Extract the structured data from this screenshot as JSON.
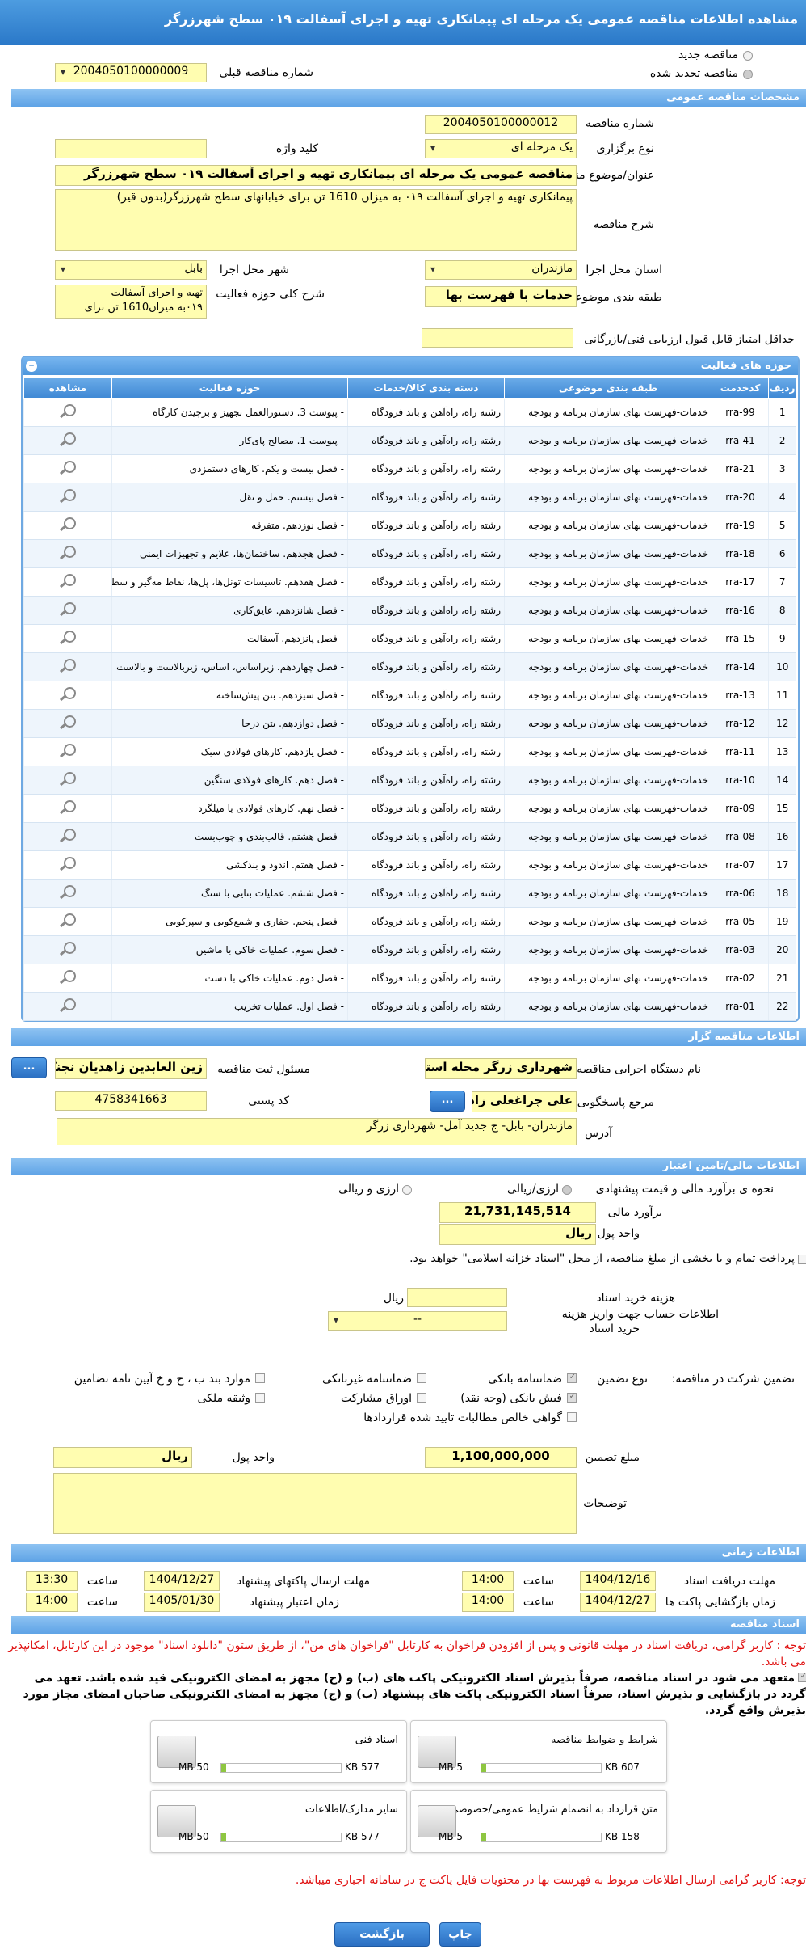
{
  "title": "مشاهده اطلاعات مناقصه عمومی یک مرحله ای پیمانکاری تهیه و اجرای آسفالت ۰۱۹ سطح شهرزرگر",
  "top": {
    "new_tender": "مناقصه جدید",
    "renewed_tender": "مناقصه تجدید شده",
    "prev_number_label": "شماره مناقصه قبلی",
    "prev_number": "2004050100000009"
  },
  "general": {
    "header": "مشخصات مناقصه عمومی",
    "number_label": "شماره مناقصه",
    "number": "2004050100000012",
    "type_label": "نوع برگزاری",
    "type": "یک مرحله ای",
    "keyword_label": "کلید واژه",
    "keyword": "",
    "subject_label": "عنوان/موضوع مناقصه",
    "subject": "مناقصه عمومی یک مرحله ای پیمانکاری تهیه و اجرای آسفالت ۰۱۹ سطح شهرزرگر",
    "desc_label": "شرح مناقصه",
    "desc": "پیمانکاری تهیه و اجرای آسفالت ۰۱۹ به میزان 1610 تن برای خیابانهای سطح شهرزرگر(بدون قیر)",
    "province_label": "استان محل اجرا",
    "province": "مازندران",
    "city_label": "شهر محل اجرا",
    "city": "بابل",
    "category_label": "طبقه بندی موضوعی",
    "category": "خدمات با فهرست بها",
    "scope_label": "شرح کلی حوزه فعالیت",
    "scope_line1": "تهیه و اجرای آسفالت",
    "scope_line2": "۰۱۹به میزان1610 تن برای",
    "min_score_label": "حداقل امتیاز قابل قبول ارزیابی فنی/بازرگانی",
    "min_score": ""
  },
  "activities": {
    "header": "حوزه های فعالیت",
    "toggle": "−",
    "columns": [
      "ردیف",
      "کدخدمت",
      "طبقه بندی موضوعی",
      "دسته بندی کالا/خدمات",
      "حوزه فعالیت",
      "مشاهده"
    ],
    "rows": [
      [
        "1",
        "rra-99",
        "خدمات-فهرست بهای سازمان برنامه و بودجه",
        "رشته راه، راه‌آهن و باند فرودگاه",
        "- پیوست 3. دستورالعمل تجهیز و برچیدن کارگاه"
      ],
      [
        "2",
        "rra-41",
        "خدمات-فهرست بهای سازمان برنامه و بودجه",
        "رشته راه، راه‌آهن و باند فرودگاه",
        "- پیوست 1. مصالح پای‌کار"
      ],
      [
        "3",
        "rra-21",
        "خدمات-فهرست بهای سازمان برنامه و بودجه",
        "رشته راه، راه‌آهن و باند فرودگاه",
        "- فصل بیست و یکم. کارهای دستمزدی"
      ],
      [
        "4",
        "rra-20",
        "خدمات-فهرست بهای سازمان برنامه و بودجه",
        "رشته راه، راه‌آهن و باند فرودگاه",
        "- فصل بیستم. حمل و نقل"
      ],
      [
        "5",
        "rra-19",
        "خدمات-فهرست بهای سازمان برنامه و بودجه",
        "رشته راه، راه‌آهن و باند فرودگاه",
        "- فصل نوزدهم. متفرقه"
      ],
      [
        "6",
        "rra-18",
        "خدمات-فهرست بهای سازمان برنامه و بودجه",
        "رشته راه، راه‌آهن و باند فرودگاه",
        "- فصل هجدهم. ساختمان‌ها، علایم و تجهیزات ایمنی"
      ],
      [
        "7",
        "rra-17",
        "خدمات-فهرست بهای سازمان برنامه و بودجه",
        "رشته راه، راه‌آهن و باند فرودگاه",
        "- فصل هفدهم. تاسیسات تونل‌ها، پل‌ها، نقاط مه‌گیر و سطوح پروازی"
      ],
      [
        "8",
        "rra-16",
        "خدمات-فهرست بهای سازمان برنامه و بودجه",
        "رشته راه، راه‌آهن و باند فرودگاه",
        "- فصل شانزدهم. عایق‌کاری"
      ],
      [
        "9",
        "rra-15",
        "خدمات-فهرست بهای سازمان برنامه و بودجه",
        "رشته راه، راه‌آهن و باند فرودگاه",
        "- فصل پانزدهم. آسفالت"
      ],
      [
        "10",
        "rra-14",
        "خدمات-فهرست بهای سازمان برنامه و بودجه",
        "رشته راه، راه‌آهن و باند فرودگاه",
        "- فصل چهاردهم. زیراساس، اساس، زیربالاست و بالاست"
      ],
      [
        "11",
        "rra-13",
        "خدمات-فهرست بهای سازمان برنامه و بودجه",
        "رشته راه، راه‌آهن و باند فرودگاه",
        "- فصل سیزدهم. بتن پیش‌ساخته"
      ],
      [
        "12",
        "rra-12",
        "خدمات-فهرست بهای سازمان برنامه و بودجه",
        "رشته راه، راه‌آهن و باند فرودگاه",
        "- فصل دوازدهم. بتن درجا"
      ],
      [
        "13",
        "rra-11",
        "خدمات-فهرست بهای سازمان برنامه و بودجه",
        "رشته راه، راه‌آهن و باند فرودگاه",
        "- فصل یازدهم. کارهای فولادی سبک"
      ],
      [
        "14",
        "rra-10",
        "خدمات-فهرست بهای سازمان برنامه و بودجه",
        "رشته راه، راه‌آهن و باند فرودگاه",
        "- فصل دهم. کارهای فولادی سنگین"
      ],
      [
        "15",
        "rra-09",
        "خدمات-فهرست بهای سازمان برنامه و بودجه",
        "رشته راه، راه‌آهن و باند فرودگاه",
        "- فصل نهم. کارهای فولادی با میلگرد"
      ],
      [
        "16",
        "rra-08",
        "خدمات-فهرست بهای سازمان برنامه و بودجه",
        "رشته راه، راه‌آهن و باند فرودگاه",
        "- فصل هشتم. قالب‌بندی و چوب‌بست"
      ],
      [
        "17",
        "rra-07",
        "خدمات-فهرست بهای سازمان برنامه و بودجه",
        "رشته راه، راه‌آهن و باند فرودگاه",
        "- فصل هفتم. اندود و بندکشی"
      ],
      [
        "18",
        "rra-06",
        "خدمات-فهرست بهای سازمان برنامه و بودجه",
        "رشته راه، راه‌آهن و باند فرودگاه",
        "- فصل ششم. عملیات بنایی با سنگ"
      ],
      [
        "19",
        "rra-05",
        "خدمات-فهرست بهای سازمان برنامه و بودجه",
        "رشته راه، راه‌آهن و باند فرودگاه",
        "- فصل پنجم. حفاری و شمع‌کوبی و سپرکوبی"
      ],
      [
        "20",
        "rra-03",
        "خدمات-فهرست بهای سازمان برنامه و بودجه",
        "رشته راه، راه‌آهن و باند فرودگاه",
        "- فصل سوم. عملیات خاکی با ماشین"
      ],
      [
        "21",
        "rra-02",
        "خدمات-فهرست بهای سازمان برنامه و بودجه",
        "رشته راه، راه‌آهن و باند فرودگاه",
        "- فصل دوم. عملیات خاکی با دست"
      ],
      [
        "22",
        "rra-01",
        "خدمات-فهرست بهای سازمان برنامه و بودجه",
        "رشته راه، راه‌آهن و باند فرودگاه",
        "- فصل اول. عملیات تخریب"
      ]
    ]
  },
  "organizer": {
    "header": "اطلاعات مناقصه گزار",
    "org_label": "نام دستگاه اجرایی مناقصه گزار",
    "org": "شهرداری زرگر محله استان",
    "resp_label": "مسئول ثبت مناقصه",
    "resp": "زین العابدین زاهدیان نجنکی",
    "ref_label": "مرجع پاسخگویی",
    "ref": "علی چراغعلی زاد",
    "postal_label": "کد پستی",
    "postal": "4758341663",
    "address_label": "آدرس",
    "address": "مازندران- بابل- ج جدید آمل- شهرداری زرگر",
    "more_btn": "..."
  },
  "finance": {
    "header": "اطلاعات مالی/تامین اعتبار",
    "method_label": "نحوه ی برآورد مالی و قیمت پیشنهادی",
    "opt_rial": "ارزی/ریالی",
    "opt_fx": "ارزی و ریالی",
    "estimate_label": "برآورد مالی",
    "estimate": "21,731,145,514",
    "currency_label": "واحد پول",
    "currency": "ریال",
    "treasury_text": "پرداخت تمام و یا بخشی از مبلغ مناقصه، از محل \"اسناد خزانه اسلامی\" خواهد بود.",
    "doc_fee_label": "هزینه خرید اسناد",
    "doc_fee": "",
    "doc_fee_unit": "ریال",
    "account_label1": "اطلاعات حساب جهت واریز هزینه",
    "account_label2": "خرید اسناد",
    "account_value": "--"
  },
  "guarantee": {
    "label": "تضمین شرکت در مناقصه:",
    "type_label": "نوع تضمین",
    "opts": [
      "ضمانتنامه بانکی",
      "ضمانتنامه غیربانکی",
      "موارد بند ب ، ج و خ آیین نامه تضامین",
      "فیش بانکی (وجه نقد)",
      "اوراق مشارکت",
      "وثیقه ملکی",
      "گواهی خالص مطالبات تایید شده قراردادها"
    ],
    "amount_label": "مبلغ تضمین",
    "amount": "1,100,000,000",
    "unit_label": "واحد پول",
    "unit": "ریال",
    "notes_label": "توضیحات",
    "notes": ""
  },
  "timing": {
    "header": "اطلاعات زمانی",
    "doc_receive_label": "مهلت دریافت اسناد",
    "doc_receive_date": "1404/12/16",
    "doc_receive_time": "14:00",
    "send_label": "مهلت ارسال پاکتهای پیشنهاد",
    "send_date": "1404/12/27",
    "send_time": "13:30",
    "open_label": "زمان بازگشایی پاکت ها",
    "open_date": "1404/12/27",
    "open_time": "14:00",
    "valid_label": "زمان اعتبار پیشنهاد",
    "valid_date": "1405/01/30",
    "valid_time": "14:00",
    "time_label": "ساعت"
  },
  "docs": {
    "header": "اسناد مناقصه",
    "note1": "توجه : کاربر گرامی، دریافت اسناد در مهلت قانونی و پس از افزودن فراخوان به کارتابل \"فراخوان های من\"، از طریق ستون \"دانلود اسناد\" موجود در این کارتابل، امکانپذیر می باشد.",
    "commit": "متعهد می شود در اسناد مناقصه، صرفاً بذیرش اسناد الکترونیکی پاکت های (ب) و (ج) مجهز به امضای الکترونیکی قید شده باشد. تعهد می گردد در بازگشایی و بذیرش اسناد، صرفاً اسناد الکترونیکی پاکت های پیشنهاد (ب) و (ج) مجهز به امضای الکترونیکی صاحبان امضای مجاز مورد بذیرش واقع گردد.",
    "files": [
      {
        "name": "شرایط و ضوابط مناقصه",
        "max": "5 MB",
        "size": "607 KB"
      },
      {
        "name": "اسناد فنی",
        "max": "50 MB",
        "size": "577 KB"
      },
      {
        "name": "متن قرارداد به انضمام شرایط عمومی/خصوصی",
        "max": "5 MB",
        "size": "158 KB"
      },
      {
        "name": "سایر مدارک/اطلاعات",
        "max": "50 MB",
        "size": "577 KB"
      }
    ],
    "note2": "توجه: کاربر گرامی ارسال اطلاعات مربوط به فهرست بها در محتویات فایل پاکت ج در سامانه اجباری میباشد."
  },
  "buttons": {
    "back": "بازگشت",
    "print": "چاپ"
  },
  "colors": {
    "header_blue": "#2a78c8",
    "field_yellow": "#fffdb0",
    "warning_red": "#e01010"
  }
}
